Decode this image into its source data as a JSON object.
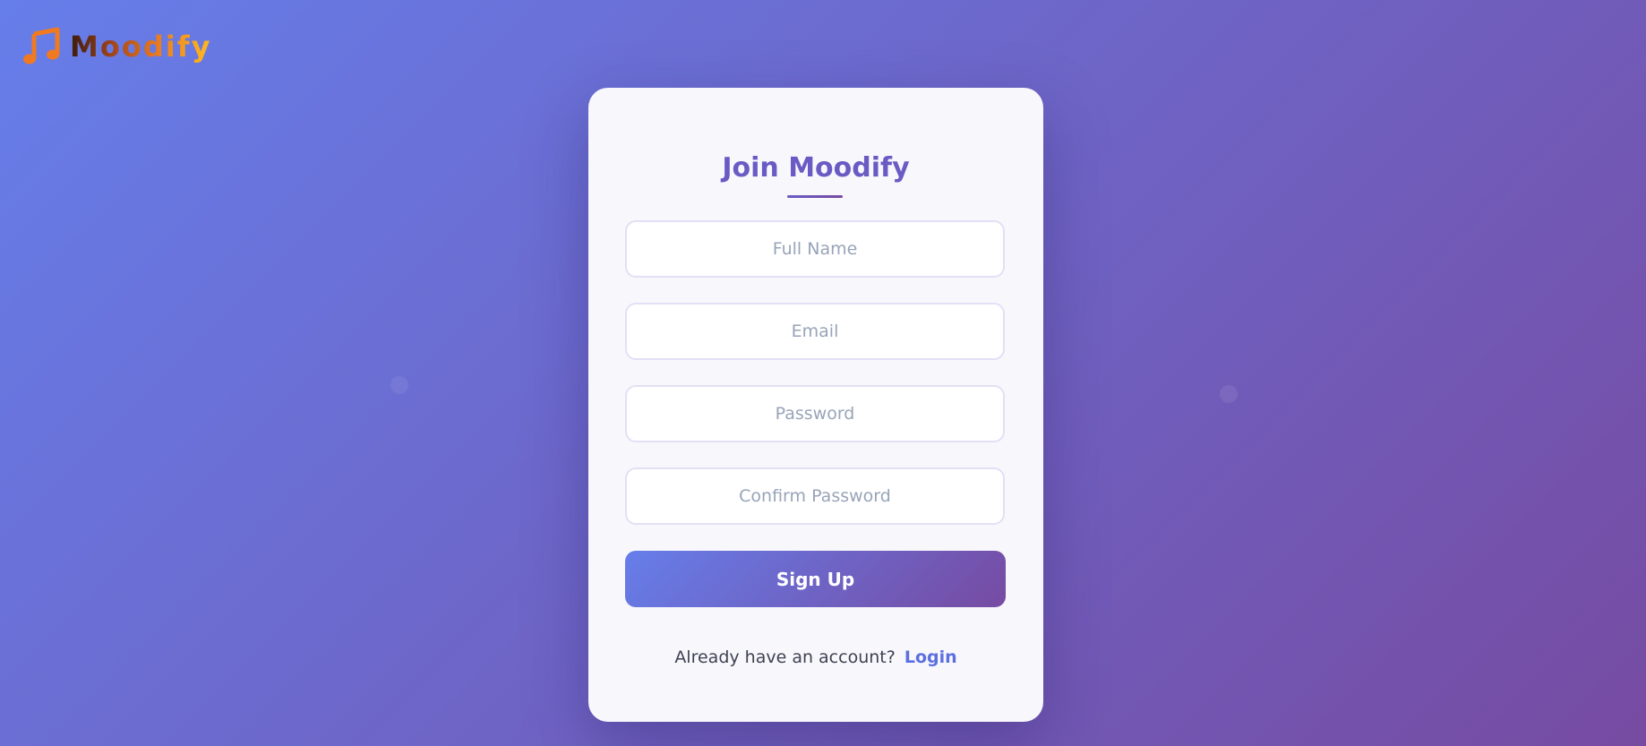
{
  "brand": {
    "name": "Moodify",
    "icon": "music-note-icon"
  },
  "signup_form": {
    "title": "Join Moodify",
    "fields": [
      {
        "placeholder": "Full Name",
        "value": ""
      },
      {
        "placeholder": "Email",
        "value": ""
      },
      {
        "placeholder": "Password",
        "value": ""
      },
      {
        "placeholder": "Confirm Password",
        "value": ""
      }
    ],
    "submit_label": "Sign Up",
    "login_prompt": "Already have an account?",
    "login_label": "Login"
  },
  "colors": {
    "background_start": "#667eea",
    "background_end": "#764ba2",
    "title": "#6a5bc4",
    "link": "#5b6fe0",
    "logo_icon": "#f07a1f"
  }
}
